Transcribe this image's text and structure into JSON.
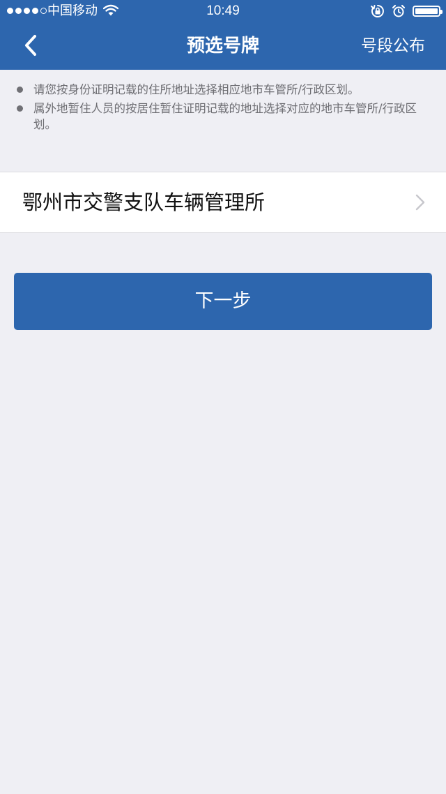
{
  "status_bar": {
    "signal_bars_filled": 4,
    "signal_bars_total": 5,
    "carrier": "中国移动",
    "time": "10:49",
    "battery_level": 1.0,
    "icons": [
      "wifi-icon",
      "orientation-lock-icon",
      "alarm-icon",
      "battery-icon"
    ]
  },
  "nav": {
    "back_icon": "chevron-left-icon",
    "title": "预选号牌",
    "right_action": "号段公布"
  },
  "notes": [
    "请您按身份证明记载的住所地址选择相应地市车管所/行政区划。",
    "属外地暂住人员的按居住暂住证明记载的地址选择对应的地市车管所/行政区划。"
  ],
  "office": {
    "label": "鄂州市交警支队车辆管理所",
    "icon": "chevron-right-icon"
  },
  "next_button": {
    "label": "下一步"
  },
  "colors": {
    "primary": "#2d66ae",
    "background": "#efeff4",
    "note_text": "#6d6d72"
  }
}
